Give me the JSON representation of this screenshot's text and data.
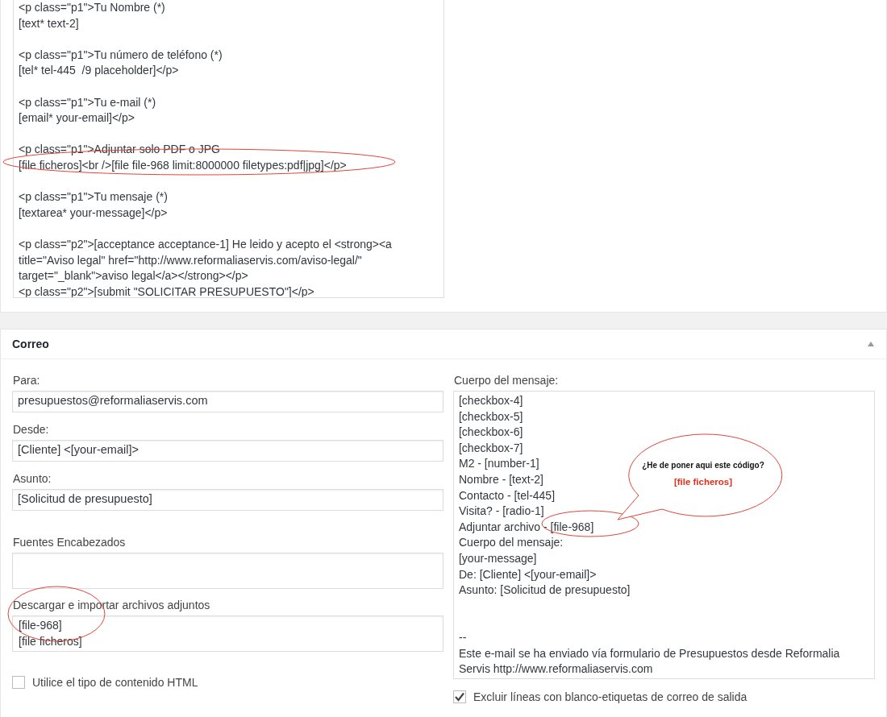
{
  "form_code": "<p class=\"p1\">Tu Nombre (*)\n[text* text-2]\n\n<p class=\"p1\">Tu número de teléfono (*)\n[tel* tel-445  /9 placeholder]</p>\n\n<p class=\"p1\">Tu e-mail (*)\n[email* your-email]</p>\n\n<p class=\"p1\">Adjuntar solo PDF o JPG\n[file ficheros]<br />[file file-968 limit:8000000 filetypes:pdf|jpg]</p>\n\n<p class=\"p1\">Tu mensaje (*)\n[textarea* your-message]</p>\n\n<p class=\"p2\">[acceptance acceptance-1] He leido y acepto el <strong><a title=\"Aviso legal\" href=\"http://www.reformaliaservis.com/aviso-legal/\" target=\"_blank\">aviso legal</a></strong></p>\n<p class=\"p2\">[submit \"SOLICITAR PRESUPUESTO\"]</p>",
  "mail": {
    "title": "Correo",
    "expanded": true,
    "fields": [
      {
        "kind": "input",
        "label": "Para:",
        "value": "presupuestos@reformaliaservis.com"
      },
      {
        "kind": "input",
        "label": "Desde:",
        "value": "[Cliente] <[your-email]>"
      },
      {
        "kind": "input",
        "label": "Asunto:",
        "value": "[Solicitud de presupuesto]"
      },
      {
        "kind": "textarea",
        "label": "Fuentes Encabezados"
      },
      {
        "kind": "textarea",
        "label": "Descargar e importar archivos adjuntos",
        "value": "[file-968]\n[file ficheros]"
      }
    ],
    "html_checkbox": {
      "label": "Utilice el tipo de contenido HTML",
      "checked": false
    },
    "body": {
      "label": "Cuerpo del mensaje:",
      "value": "[checkbox-4]\n[checkbox-5]\n[checkbox-6]\n[checkbox-7]\nM2 - [number-1]\nNombre - [text-2]\nContacto - [tel-445]\nVisita? - [radio-1]\nAdjuntar archivo - [file-968]\nCuerpo del mensaje:\n[your-message]\nDe: [Cliente] <[your-email]>\nAsunto: [Solicitud de presupuesto]\n\n\n--\nEste e-mail se ha enviado vía formulario de Presupuestos desde Reformalia Servis http://www.reformaliaservis.com"
    },
    "exclude_checkbox": {
      "label": "Excluir líneas con blanco-etiquetas de correo de salida",
      "checked": true
    }
  },
  "callout": {
    "question": "¿He de poner aqui este código?",
    "code": "[file ficheros]"
  }
}
